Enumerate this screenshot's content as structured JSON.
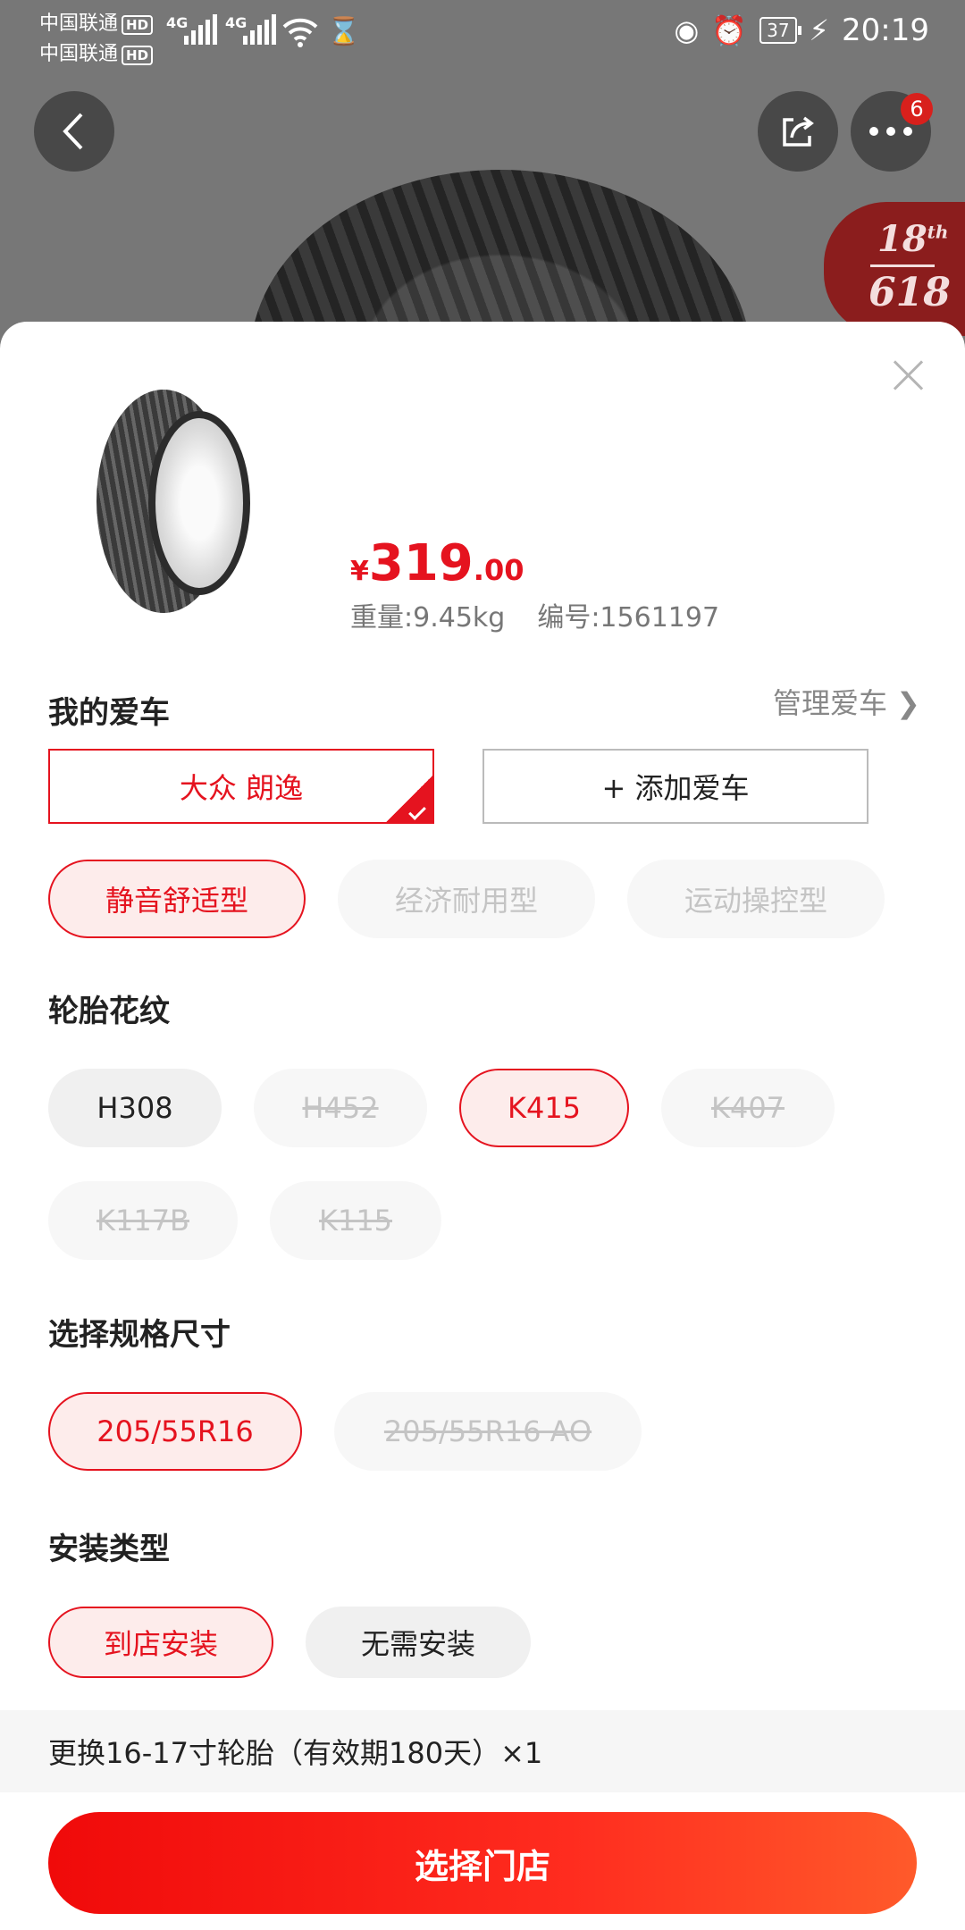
{
  "status_bar": {
    "carrier1": "中国联通",
    "carrier2": "中国联通",
    "hd": "HD",
    "network1": "4G",
    "network2": "4G",
    "battery": "37",
    "time": "20:19"
  },
  "header": {
    "more_badge": "6",
    "promo": {
      "line1": "18",
      "sup": "th",
      "line2": "618"
    }
  },
  "product": {
    "price_currency": "¥",
    "price_int": "319",
    "price_dec": ".00",
    "weight": "重量:9.45kg",
    "sku": "编号:1561197"
  },
  "my_car": {
    "title": "我的爱车",
    "manage": "管理爱车 ❯",
    "selected_car": "大众 朗逸",
    "add_car": "+ 添加爱车"
  },
  "type_options": [
    {
      "label": "静音舒适型",
      "state": "active"
    },
    {
      "label": "经济耐用型",
      "state": "disabled"
    },
    {
      "label": "运动操控型",
      "state": "disabled"
    }
  ],
  "pattern": {
    "title": "轮胎花纹",
    "options": [
      {
        "label": "H308",
        "state": "normal"
      },
      {
        "label": "H452",
        "state": "strike"
      },
      {
        "label": "K415",
        "state": "active"
      },
      {
        "label": "K407",
        "state": "strike"
      },
      {
        "label": "K117B",
        "state": "strike"
      },
      {
        "label": "K115",
        "state": "strike"
      }
    ]
  },
  "size": {
    "title": "选择规格尺寸",
    "options": [
      {
        "label": "205/55R16",
        "state": "active"
      },
      {
        "label": "205/55R16 AO",
        "state": "strike"
      }
    ]
  },
  "install": {
    "title": "安装类型",
    "options": [
      {
        "label": "到店安装",
        "state": "active"
      },
      {
        "label": "无需安装",
        "state": "normal"
      }
    ]
  },
  "notice": "更换16-17寸轮胎（有效期180天）×1",
  "cta": "选择门店",
  "colors": {
    "accent": "#e5131f",
    "cta_start": "#f00a0a",
    "cta_end": "#ff5a2a"
  }
}
